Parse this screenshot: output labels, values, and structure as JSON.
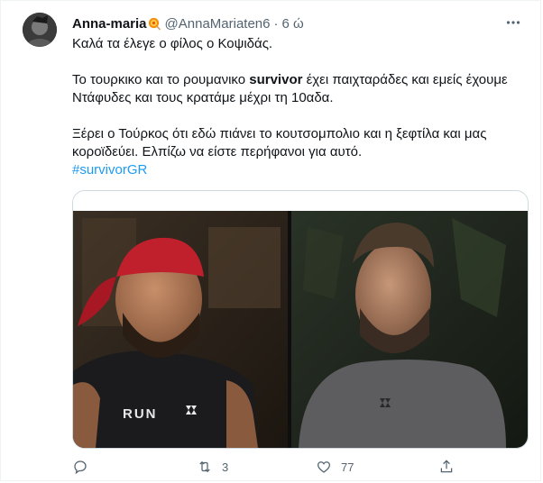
{
  "tweet": {
    "author_name": "Anna-maria",
    "author_handle": "@AnnaMariaten6",
    "separator": "·",
    "time": "6 ώ",
    "line1": "Καλά τα έλεγε ο φίλος ο Κοψιδάς.",
    "line2_pre": "Το τουρκικο και το ρουμανικο ",
    "line2_bold": "survivor",
    "line2_post": " έχει παιχταράδες και εμείς έχουμε Ντάφυδες και τους κρατάμε μέχρι τη 10αδα.",
    "line3": "Ξέρει ο Τούρκος ότι εδώ πιάνει το κουτσομπολιο και η ξεφτίλα και μας κοροϊδεύει. Ελπίζω να είστε περήφανοι για αυτό.",
    "hashtag": "#survivorGR"
  },
  "media": {
    "shirt_text_run": "RUN",
    "brand_mark": "UNDER ARMOUR"
  },
  "actions": {
    "reply_count": "",
    "retweet_count": "3",
    "like_count": "77",
    "share_count": ""
  },
  "colors": {
    "link": "#1d9bf0",
    "muted": "#536471",
    "text": "#0f1419"
  }
}
